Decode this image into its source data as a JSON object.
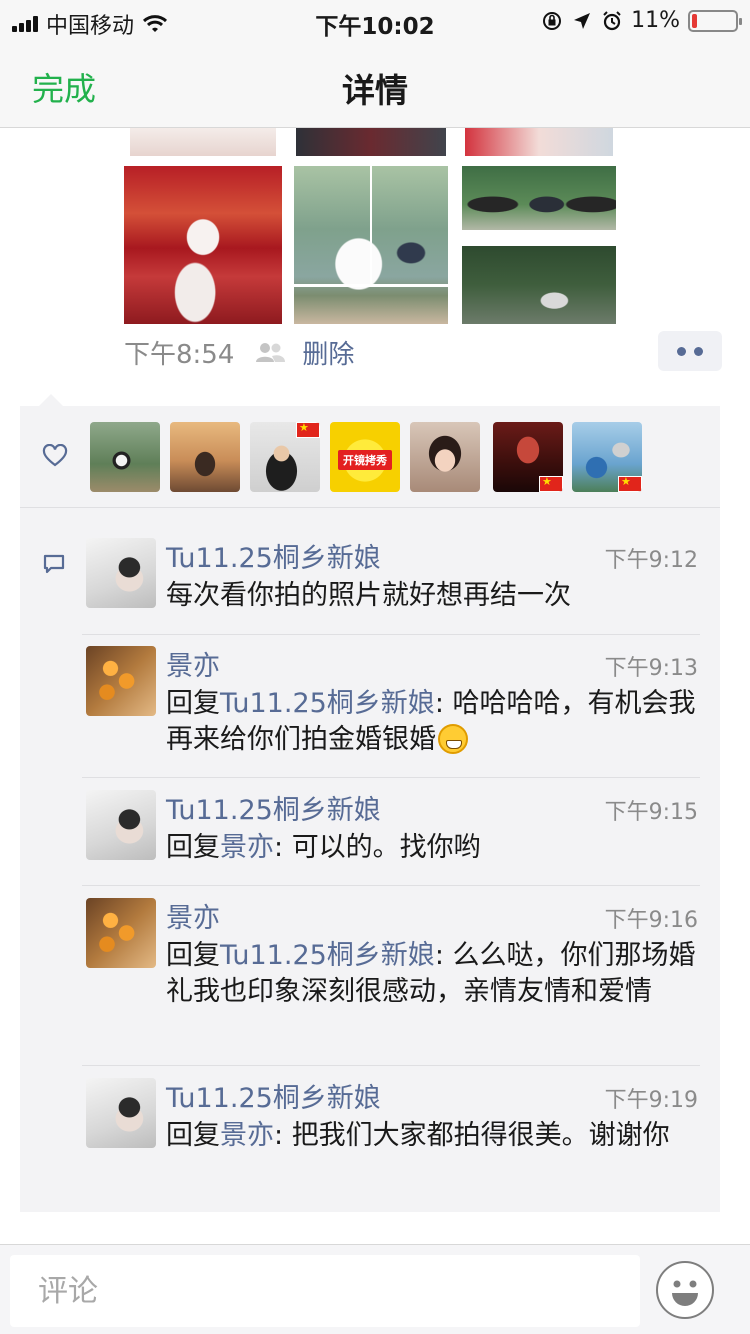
{
  "status_bar": {
    "carrier": "中国移动",
    "time": "下午10:02",
    "battery_percent_label": "11%",
    "battery_level": 0.11
  },
  "nav": {
    "done_label": "完成",
    "title": "详情"
  },
  "post": {
    "time": "下午8:54",
    "delete_label": "删除"
  },
  "likes": {
    "icon": "heart-icon",
    "avatars": [
      {
        "name": "liker-1"
      },
      {
        "name": "liker-2"
      },
      {
        "name": "liker-3"
      },
      {
        "name": "liker-4",
        "badge": "开镜拷秀"
      },
      {
        "name": "liker-5"
      },
      {
        "name": "liker-6"
      },
      {
        "name": "liker-7"
      }
    ]
  },
  "comments": [
    {
      "author": "Tu11.25桐乡新娘",
      "time": "下午9:12",
      "reply_to": "",
      "separator": "",
      "text": "每次看你拍的照片就好想再结一次"
    },
    {
      "author": "景亦",
      "time": "下午9:13",
      "reply_prefix": "回复",
      "reply_to": "Tu11.25桐乡新娘",
      "separator": ": ",
      "text": "哈哈哈哈，有机会我再来给你们拍金婚银婚"
    },
    {
      "author": "Tu11.25桐乡新娘",
      "time": "下午9:15",
      "reply_prefix": "回复",
      "reply_to": "景亦",
      "separator": ": ",
      "text": "可以的。找你哟"
    },
    {
      "author": "景亦",
      "time": "下午9:16",
      "reply_prefix": "回复",
      "reply_to": "Tu11.25桐乡新娘",
      "separator": ": ",
      "text": "么么哒，你们那场婚礼我也印象深刻很感动，亲情友情和爱情"
    },
    {
      "author": "Tu11.25桐乡新娘",
      "time": "下午9:19",
      "reply_prefix": "回复",
      "reply_to": "景亦",
      "separator": ": ",
      "text": "把我们大家都拍得很美。谢谢你"
    }
  ],
  "input": {
    "placeholder": "评论"
  },
  "colors": {
    "accent_green": "#22b14c",
    "link_blue": "#576b95",
    "battery_low": "#e53935"
  }
}
